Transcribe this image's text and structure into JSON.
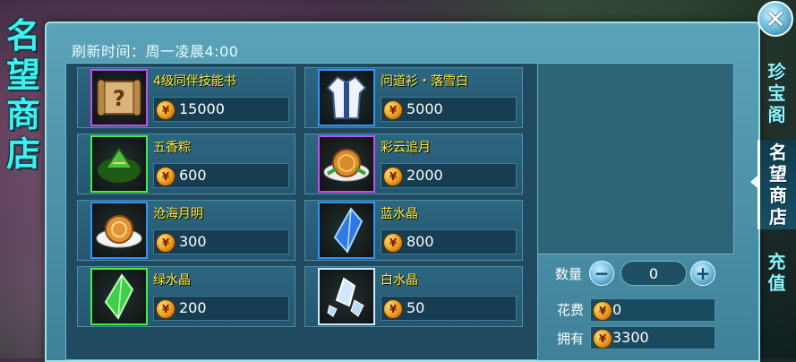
{
  "title_chars": [
    "名",
    "望",
    "商",
    "店"
  ],
  "refresh_text": "刷新时间：周一凌晨4:00",
  "items": [
    {
      "name": "4级同伴技能书",
      "price": "15000",
      "icon": "scroll-icon",
      "rarity": "purple"
    },
    {
      "name": "问道衫・落雪白",
      "price": "5000",
      "icon": "robe-icon",
      "rarity": "blue"
    },
    {
      "name": "五香粽",
      "price": "600",
      "icon": "zongzi-icon",
      "rarity": "green"
    },
    {
      "name": "彩云追月",
      "price": "2000",
      "icon": "mooncake-plate-icon",
      "rarity": "purple"
    },
    {
      "name": "沧海月明",
      "price": "300",
      "icon": "mooncake-icon",
      "rarity": "blue"
    },
    {
      "name": "蓝水晶",
      "price": "800",
      "icon": "blue-crystal-icon",
      "rarity": "blue"
    },
    {
      "name": "绿水晶",
      "price": "200",
      "icon": "green-crystal-icon",
      "rarity": "green"
    },
    {
      "name": "白水晶",
      "price": "50",
      "icon": "white-crystal-icon",
      "rarity": "white"
    }
  ],
  "quantity": {
    "label": "数量",
    "value": "0",
    "minus": "−",
    "plus": "+"
  },
  "cost": {
    "label": "花费",
    "value": "0"
  },
  "owned": {
    "label": "拥有",
    "value": "3300"
  },
  "tabs": [
    {
      "chars": [
        "珍",
        "宝",
        "阁"
      ],
      "active": false
    },
    {
      "chars": [
        "名",
        "望",
        "商",
        "店"
      ],
      "active": true
    },
    {
      "chars": [
        "充",
        "值"
      ],
      "active": false
    }
  ],
  "close_symbol": "✕",
  "coin_symbol": "¥"
}
